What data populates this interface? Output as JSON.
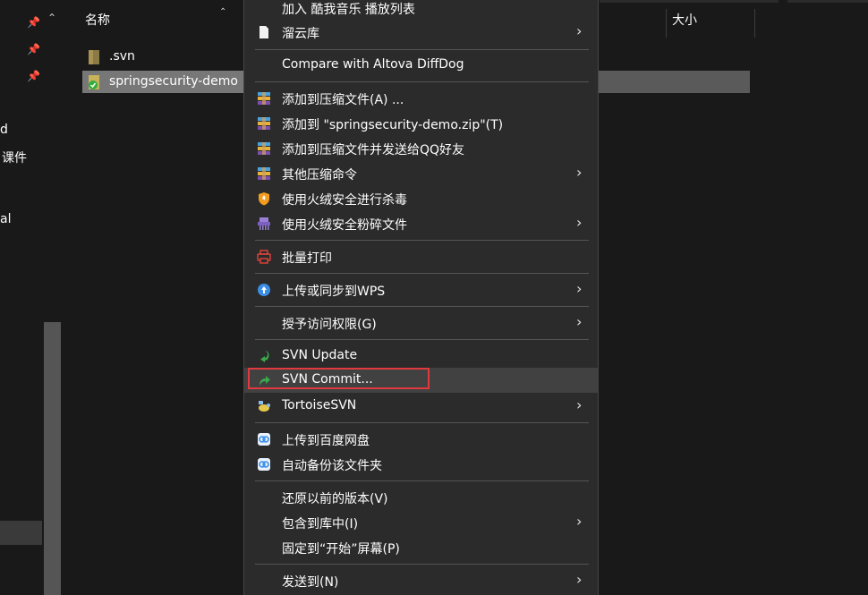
{
  "nav": {
    "items": [
      "d",
      "课件",
      "al"
    ]
  },
  "columns": {
    "name": "名称",
    "size": "大小"
  },
  "files": [
    {
      "name": ".svn",
      "icon": "folder-icon"
    },
    {
      "name": "springsecurity-demo",
      "icon": "svn-folder-icon"
    }
  ],
  "context_menu": {
    "top_item": "加入 酷我音乐 播放列表",
    "items": [
      {
        "label": "溜云库",
        "icon": "document-icon",
        "submenu": true
      },
      {
        "label": "Compare with Altova DiffDog",
        "icon": "",
        "submenu": false
      },
      {
        "label": "添加到压缩文件(A) ...",
        "icon": "winrar-icon",
        "submenu": false
      },
      {
        "label": "添加到 \"springsecurity-demo.zip\"(T)",
        "icon": "winrar-icon",
        "submenu": false
      },
      {
        "label": "添加到压缩文件并发送给QQ好友",
        "icon": "winrar-icon",
        "submenu": false
      },
      {
        "label": "其他压缩命令",
        "icon": "winrar-icon",
        "submenu": true
      },
      {
        "label": "使用火绒安全进行杀毒",
        "icon": "huorong-shield-icon",
        "submenu": false
      },
      {
        "label": "使用火绒安全粉碎文件",
        "icon": "shredder-icon",
        "submenu": true
      },
      {
        "label": "批量打印",
        "icon": "printer-icon",
        "submenu": false
      },
      {
        "label": "上传或同步到WPS",
        "icon": "cloud-upload-icon",
        "submenu": true
      },
      {
        "label": "授予访问权限(G)",
        "icon": "",
        "submenu": true
      },
      {
        "label": "SVN Update",
        "icon": "svn-update-icon",
        "submenu": false
      },
      {
        "label": "SVN Commit...",
        "icon": "svn-commit-icon",
        "submenu": false
      },
      {
        "label": "TortoiseSVN",
        "icon": "tortoise-icon",
        "submenu": true
      },
      {
        "label": "上传到百度网盘",
        "icon": "baidu-cloud-icon",
        "submenu": false
      },
      {
        "label": "自动备份该文件夹",
        "icon": "baidu-cloud-icon",
        "submenu": false
      },
      {
        "label": "还原以前的版本(V)",
        "icon": "",
        "submenu": false
      },
      {
        "label": "包含到库中(I)",
        "icon": "",
        "submenu": true
      },
      {
        "label": "固定到“开始”屏幕(P)",
        "icon": "",
        "submenu": false
      },
      {
        "label": "发送到(N)",
        "icon": "",
        "submenu": true
      }
    ],
    "arrow_glyph": "›"
  },
  "colors": {
    "background": "#191919",
    "menu_background": "#2b2b2b",
    "highlight_border": "#e0393e",
    "selected_row": "#5a5a5a"
  }
}
